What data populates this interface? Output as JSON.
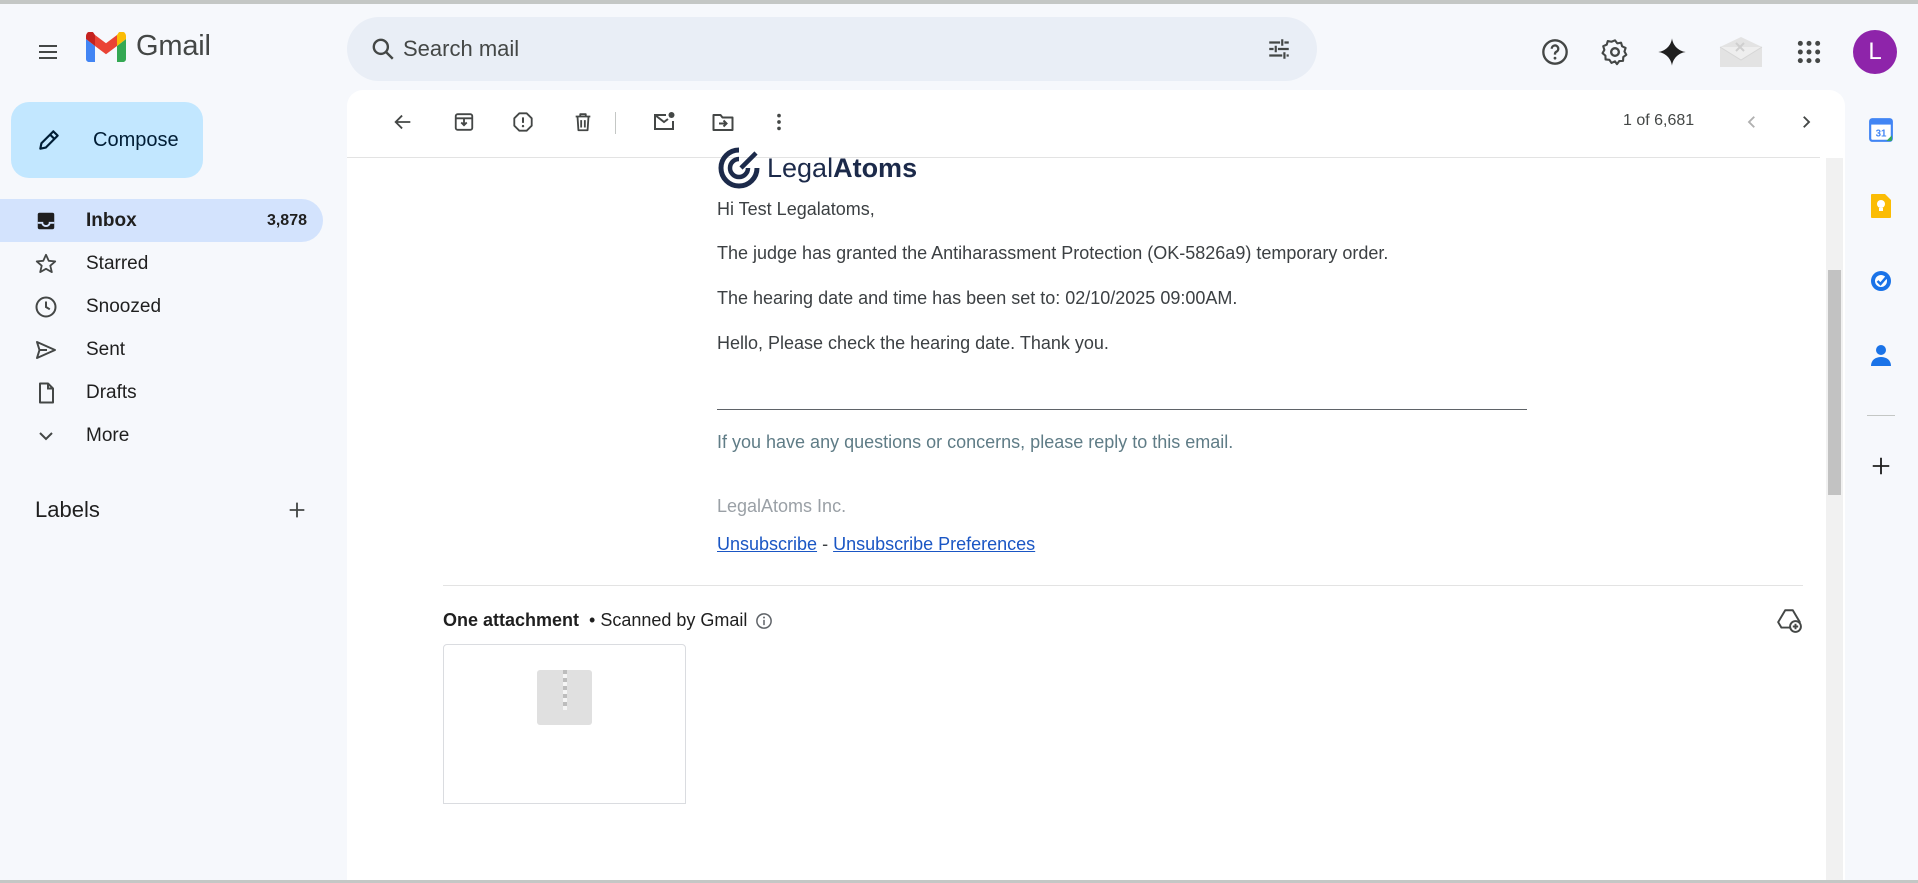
{
  "app": {
    "name": "Gmail",
    "avatar_letter": "L",
    "avatar_color": "#8e24aa",
    "accent": "#c2e7ff"
  },
  "search": {
    "placeholder": "Search mail"
  },
  "header_icons": [
    "help-icon",
    "settings-icon",
    "gemini-sparkle-icon",
    "offline-mail-icon",
    "apps-grid-icon"
  ],
  "compose": {
    "label": "Compose"
  },
  "sidebar": {
    "items": [
      {
        "label": "Inbox",
        "count": "3,878",
        "icon": "inbox-icon",
        "active": true
      },
      {
        "label": "Starred",
        "count": "",
        "icon": "star-icon"
      },
      {
        "label": "Snoozed",
        "count": "",
        "icon": "clock-icon"
      },
      {
        "label": "Sent",
        "count": "",
        "icon": "send-icon"
      },
      {
        "label": "Drafts",
        "count": "",
        "icon": "draft-icon"
      },
      {
        "label": "More",
        "count": "",
        "icon": "chevron-down-icon"
      }
    ],
    "labels_title": "Labels"
  },
  "toolbar": {
    "counter": "1 of 6,681",
    "icons": [
      "back-arrow-icon",
      "archive-icon",
      "report-spam-icon",
      "delete-icon",
      "mark-unread-icon",
      "move-to-icon",
      "more-vert-icon",
      "prev-icon",
      "next-icon"
    ]
  },
  "email": {
    "brand_light": "Legal",
    "brand_bold": "Atoms",
    "greeting": "Hi Test Legalatoms,",
    "line1": "The judge has granted the Antiharassment Protection (OK-5826a9) temporary order.",
    "line2": "The hearing date and time has been set to: 02/10/2025 09:00AM.",
    "line3": "Hello, Please check the hearing date. Thank you.",
    "footer_note": "If you have any questions or concerns, please reply to this email.",
    "company": "LegalAtoms Inc.",
    "unsubscribe": "Unsubscribe",
    "separator": "-",
    "unsubscribe_prefs": "Unsubscribe Preferences"
  },
  "attachments": {
    "title": "One attachment",
    "scanned": "• Scanned by Gmail"
  },
  "right_rail": [
    "calendar-icon",
    "keep-icon",
    "tasks-icon",
    "contacts-icon",
    "add-addon-icon"
  ],
  "rail_calendar_day": "31"
}
